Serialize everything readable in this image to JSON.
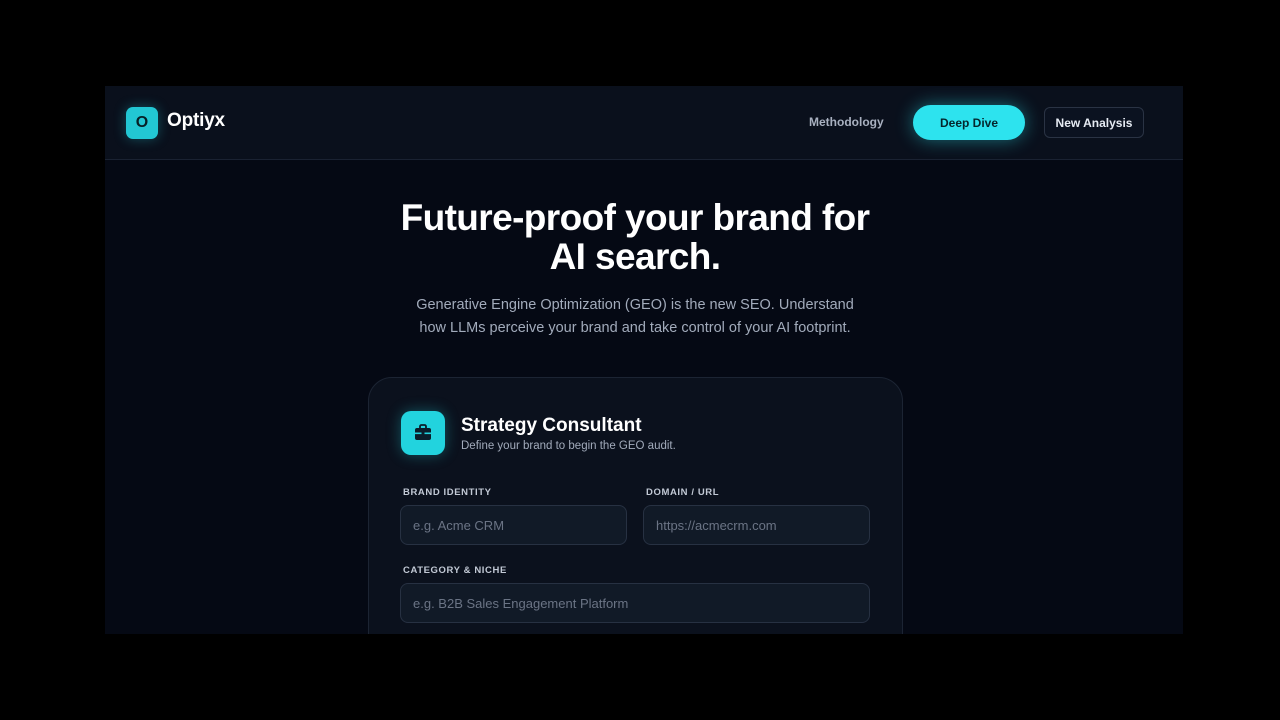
{
  "header": {
    "logo_letter": "O",
    "brand": "Optiyx",
    "nav_methodology": "Methodology",
    "deep_dive_label": "Deep Dive",
    "new_analysis_label": "New Analysis"
  },
  "hero": {
    "title_line1": "Future-proof your brand for",
    "title_line2": "AI search.",
    "subtitle_line1": "Generative Engine Optimization (GEO) is the new SEO. Understand",
    "subtitle_line2": "how LLMs perceive your brand and take control of your AI footprint."
  },
  "card": {
    "icon": "briefcase-icon",
    "title": "Strategy Consultant",
    "subtitle": "Define your brand to begin the GEO audit.",
    "fields": {
      "brand_identity": {
        "label": "BRAND IDENTITY",
        "value": "",
        "placeholder": "e.g. Acme CRM"
      },
      "domain": {
        "label": "DOMAIN / URL",
        "value": "",
        "placeholder": "https://acmecrm.com"
      },
      "category": {
        "label": "CATEGORY & NICHE",
        "value": "",
        "placeholder": "e.g. B2B Sales Engagement Platform"
      }
    }
  },
  "colors": {
    "accent": "#2de3ee",
    "background": "#050914",
    "header_bg": "#0a101c",
    "card_bg": "#0b111d"
  }
}
